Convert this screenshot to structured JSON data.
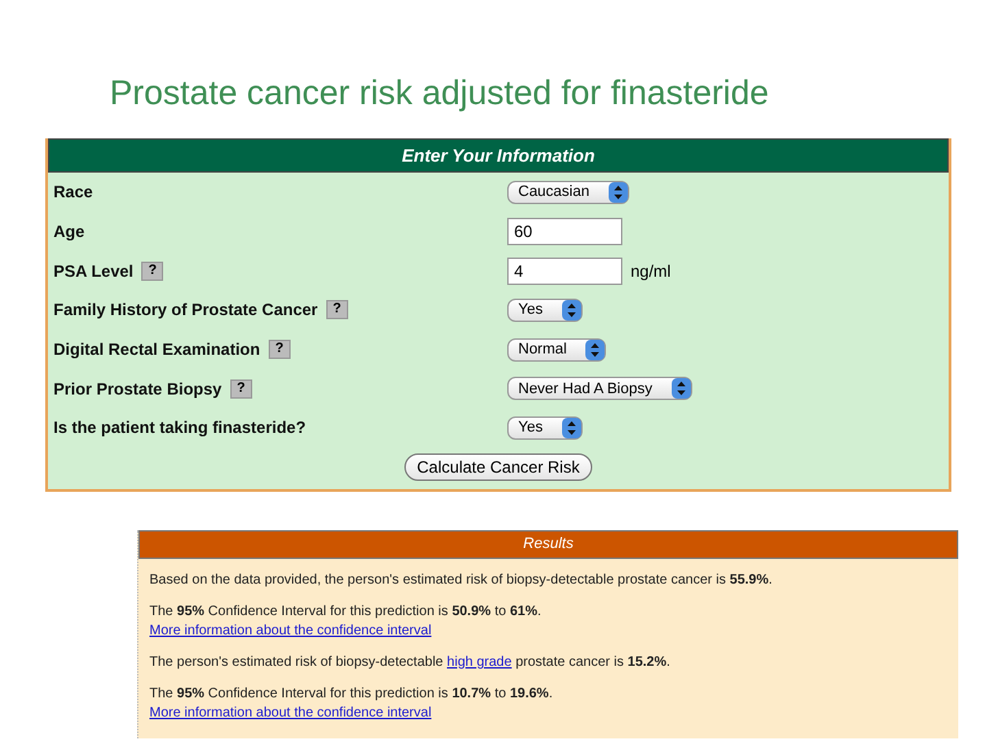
{
  "title": "Prostate cancer risk adjusted for finasteride",
  "form": {
    "header": "Enter Your Information",
    "fields": [
      {
        "label": "Race",
        "kind": "select",
        "value": "Caucasian"
      },
      {
        "label": "Age",
        "kind": "text",
        "value": "60"
      },
      {
        "label": "PSA Level",
        "help": "?",
        "kind": "text",
        "value": "4",
        "unit": "ng/ml"
      },
      {
        "label": "Family History of Prostate Cancer",
        "help": "?",
        "kind": "select",
        "value": "Yes"
      },
      {
        "label": "Digital Rectal Examination",
        "help": "?",
        "kind": "select",
        "value": "Normal"
      },
      {
        "label": "Prior Prostate Biopsy",
        "help": "?",
        "kind": "select",
        "value": "Never Had A Biopsy"
      },
      {
        "label": "Is the patient taking finasteride?",
        "kind": "select",
        "value": "Yes"
      }
    ],
    "button": "Calculate Cancer Risk"
  },
  "results": {
    "header": "Results",
    "blocks": [
      {
        "segments": [
          {
            "kind": "text",
            "text": "Based on the data provided, the person's estimated risk of biopsy-detectable prostate cancer is **55.9%**."
          }
        ]
      },
      {
        "segments": [
          {
            "kind": "text",
            "text": "The **95%** Confidence Interval for this prediction is **50.9%** to **61%**."
          }
        ],
        "link": "More information about the confidence interval"
      },
      {
        "segments": [
          {
            "kind": "text",
            "text": "The person's estimated risk of biopsy-detectable "
          },
          {
            "kind": "link",
            "text": "high grade"
          },
          {
            "kind": "text",
            "text": " prostate cancer is **15.2%**."
          }
        ]
      },
      {
        "segments": [
          {
            "kind": "text",
            "text": "The **95%** Confidence Interval for this prediction is **10.7%** to **19.6%**."
          }
        ],
        "link": "More information about the confidence interval"
      }
    ]
  }
}
